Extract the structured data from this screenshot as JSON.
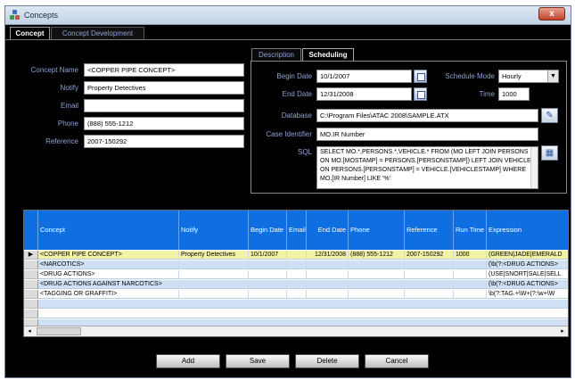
{
  "window": {
    "title": "Concepts",
    "close_label": "x"
  },
  "outer_tabs": [
    "Concept",
    "Concept Development"
  ],
  "concept_fields": [
    {
      "label": "Concept Name",
      "value": "<COPPER PIPE CONCEPT>"
    },
    {
      "label": "Notify",
      "value": "Property Detectives"
    },
    {
      "label": "Email",
      "value": ""
    },
    {
      "label": "Phone",
      "value": "(888) 555-1212"
    },
    {
      "label": "Reference",
      "value": "2007-150292"
    }
  ],
  "inner_tabs": [
    "Description",
    "Scheduling"
  ],
  "scheduling": {
    "begin_date_label": "Begin Date",
    "begin_date": "10/1/2007",
    "end_date_label": "End Date",
    "end_date": "12/31/2008",
    "schedule_mode_label": "Schedule Mode",
    "schedule_mode": "Hourly",
    "time_label": "Time",
    "time": "1000",
    "database_label": "Database",
    "database": "C:\\Program Files\\ATAC 2008\\SAMPLE.ATX",
    "case_identifier_label": "Case Identifier",
    "case_identifier": "MO.IR Number",
    "sql_label": "SQL",
    "sql": "SELECT MO.*,PERSONS.*,VEHICLE.* FROM (MO LEFT JOIN PERSONS ON MO.[MOSTAMP] = PERSONS.[PERSONSTAMP]) LEFT JOIN VEHICLE ON PERSONS.[PERSONSTAMP] = VEHICLE.[VEHICLESTAMP] WHERE MO.[IR Number] LIKE '%'"
  },
  "grid": {
    "columns": [
      "Concept",
      "Notify",
      "Begin Date",
      "Email",
      "End Date",
      "Phone",
      "Reference",
      "Run Time",
      "Expression"
    ],
    "current_row_marker": "▶",
    "rows": [
      [
        "<COPPER PIPE CONCEPT>",
        "Property Detectives",
        "10/1/2007",
        "",
        "12/31/2008",
        "(888) 555-1212",
        "2007-150292",
        "1000",
        "(GREEN|JADE|EMERALD"
      ],
      [
        "<NARCOTICS>",
        "",
        "",
        "",
        "",
        "",
        "",
        "",
        "(\\b(?:<DRUG ACTIONS>"
      ],
      [
        "<DRUG ACTIONS>",
        "",
        "",
        "",
        "",
        "",
        "",
        "",
        "(USE|SNORT|SALE|SELL"
      ],
      [
        "<DRUG ACTIONS AGAINST NARCOTICS>",
        "",
        "",
        "",
        "",
        "",
        "",
        "",
        "(\\b(?:<DRUG ACTIONS>"
      ],
      [
        "<TAGGING OR GRAFFITI>",
        "",
        "",
        "",
        "",
        "",
        "",
        "",
        "\\b(?:TAG.+\\W+(?:\\w+\\W"
      ]
    ]
  },
  "buttons": {
    "add": "Add",
    "save": "Save",
    "delete": "Delete",
    "cancel": "Cancel"
  },
  "colors": {
    "label_blue": "#8fa3d8",
    "grid_header": "#0f6fe0",
    "row_selected": "#f3f3a6",
    "row_alt": "#cfe0f5"
  }
}
